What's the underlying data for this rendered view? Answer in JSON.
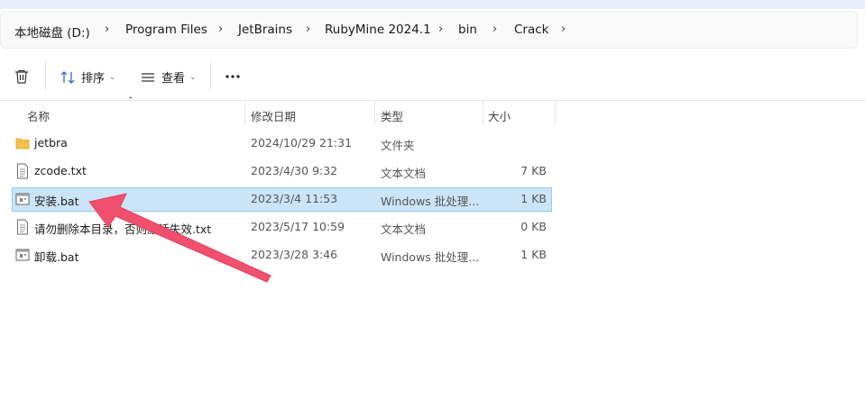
{
  "colors": {
    "accent_arrow": "#f0506e",
    "selected_row_bg": "#cce4f7",
    "folder_yellow": "#f6c24a"
  },
  "breadcrumb": {
    "items": [
      "本地磁盘 (D:)",
      "Program Files",
      "JetBrains",
      "RubyMine 2024.1",
      "bin",
      "Crack"
    ],
    "separator": "›"
  },
  "toolbar": {
    "delete_icon": "trash-icon",
    "sort_label": "排序",
    "view_label": "查看",
    "more_icon": "more-icon"
  },
  "columns": {
    "name": "名称",
    "modified": "修改日期",
    "type": "类型",
    "size": "大小"
  },
  "files": [
    {
      "name": "jetbra",
      "modified": "2024/10/29 21:31",
      "type": "文件夹",
      "size": "",
      "icon": "folder-icon",
      "selected": false
    },
    {
      "name": "zcode.txt",
      "modified": "2023/4/30 9:32",
      "type": "文本文档",
      "size": "7 KB",
      "icon": "text-file-icon",
      "selected": false
    },
    {
      "name": "安装.bat",
      "modified": "2023/3/4 11:53",
      "type": "Windows 批处理...",
      "size": "1 KB",
      "icon": "batch-file-icon",
      "selected": true
    },
    {
      "name": "请勿删除本目录，否则激活失效.txt",
      "modified": "2023/5/17 10:59",
      "type": "文本文档",
      "size": "0 KB",
      "icon": "text-file-icon",
      "selected": false
    },
    {
      "name": "卸载.bat",
      "modified": "2023/3/28 3:46",
      "type": "Windows 批处理...",
      "size": "1 KB",
      "icon": "batch-file-icon",
      "selected": false
    }
  ]
}
